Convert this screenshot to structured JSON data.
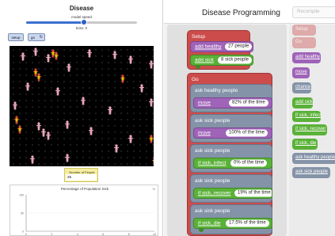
{
  "model": {
    "title": "Disease",
    "speed_label": "model speed",
    "speed_fraction": 0.52,
    "ticks_text": "ticks: 0",
    "setup_label": "setup",
    "go_label": "go",
    "monitor": {
      "label": "Number of People",
      "value": "25"
    },
    "plot": {
      "title": "Percentage of Population Sick",
      "corner": "%",
      "y_ticks": [
        "100",
        "50",
        "0"
      ],
      "x_ticks": [
        "0",
        "2",
        "4",
        "6",
        "8",
        "10"
      ]
    },
    "colors": {
      "healthy": "#e8a7b9",
      "sick_shirt": "#e5c300",
      "sick_body": "#d7443a",
      "world_bg": "#000000"
    }
  },
  "editor": {
    "title": "Disease Programming",
    "recompile_label": "Recompile",
    "blocks": {
      "setup": "Setup",
      "add_healthy": {
        "label": "add healthy",
        "value": "27 people"
      },
      "add_sick": {
        "label": "add sick",
        "value": "8 sick people"
      },
      "go": "Go",
      "ask_healthy": "ask healthy people",
      "move1": {
        "label": "move",
        "value": "82% of the time"
      },
      "ask_sick1": "ask sick people",
      "move2": {
        "label": "move",
        "value": "100% of the time"
      },
      "ask_sick2": "ask sick people",
      "infect": {
        "label": "if sick, infect",
        "value": "0% of the time"
      },
      "ask_sick3": "ask sick people",
      "recover": {
        "label": "if sick, recover",
        "value": "19% of the time"
      },
      "ask_sick4": "ask sick people",
      "die": {
        "label": "if sick, die",
        "value": "17.5% of the time"
      }
    },
    "palette": [
      {
        "label": "Setup",
        "color": "#cc4b4b",
        "faded": true
      },
      {
        "label": "Go",
        "color": "#cc4b4b",
        "faded": true
      },
      {
        "label": "add healthy",
        "color": "#9f63b8",
        "faded": false
      },
      {
        "label": "move",
        "color": "#9f63b8",
        "faded": false
      },
      {
        "label": "chance",
        "color": "#8493a8",
        "faded": false
      },
      {
        "label": "add sick",
        "color": "#5ab138",
        "faded": false
      },
      {
        "label": "if sick, infect",
        "color": "#5ab138",
        "faded": false
      },
      {
        "label": "if sick, recover",
        "color": "#5ab138",
        "faded": false
      },
      {
        "label": "if sick, die",
        "color": "#5ab138",
        "faded": false
      },
      {
        "label": "ask healthy people",
        "color": "#8493a8",
        "faded": false
      },
      {
        "label": "ask sick people",
        "color": "#8493a8",
        "faded": false
      }
    ]
  }
}
